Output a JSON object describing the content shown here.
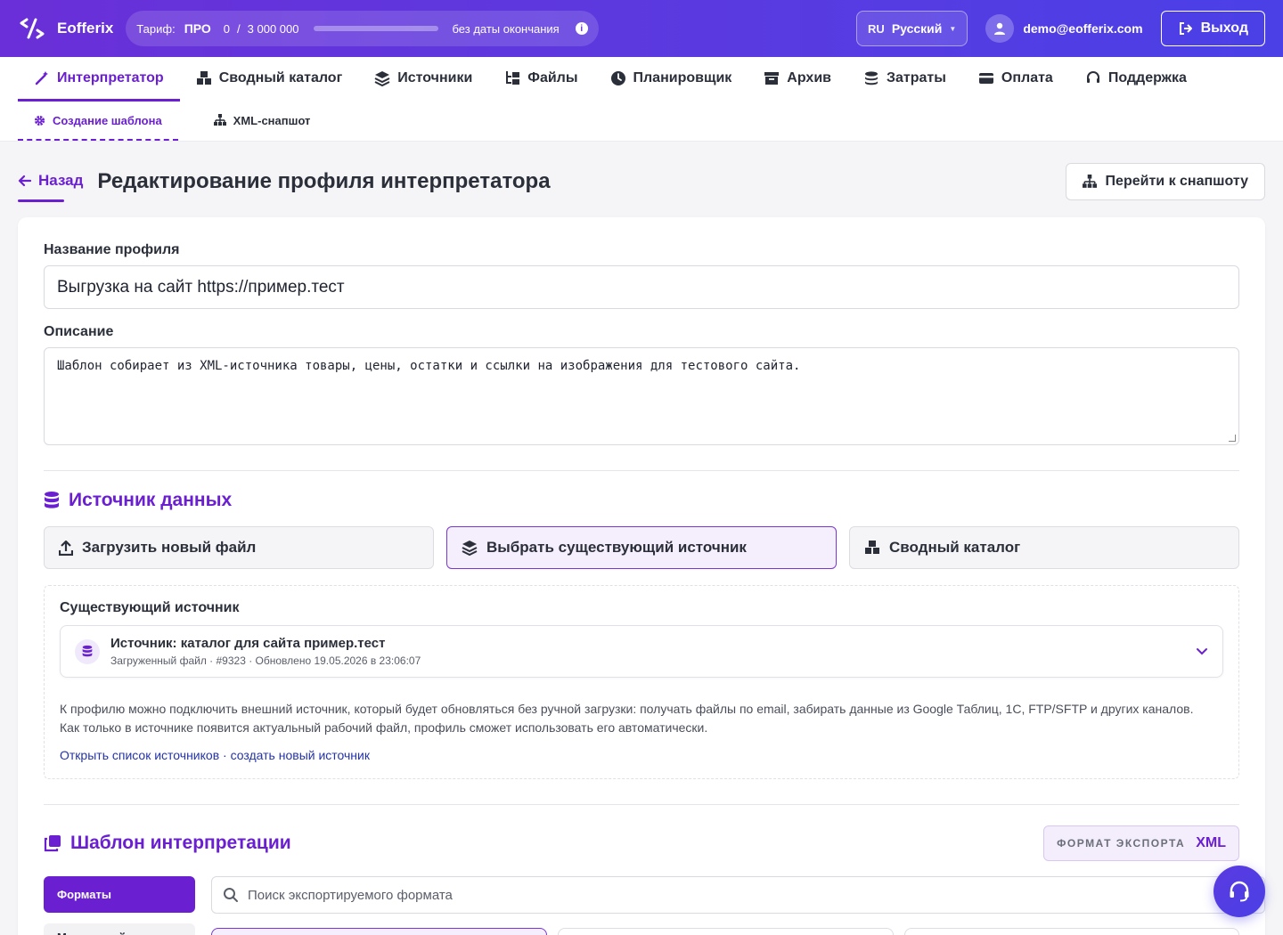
{
  "brand": {
    "name": "Eofferix"
  },
  "plan": {
    "label": "Тариф:",
    "name": "ПРО",
    "usage": "0",
    "separator": "/",
    "limit": "3 000 000",
    "usage_fraction": 0,
    "expiry": "без даты окончания"
  },
  "language": {
    "code": "RU",
    "name": "Русский"
  },
  "user": {
    "email": "demo@eofferix.com"
  },
  "logout_label": "Выход",
  "nav": [
    {
      "label": "Интерпретатор",
      "icon": "magic-wand-icon",
      "active": true
    },
    {
      "label": "Сводный каталог",
      "icon": "boxes-icon"
    },
    {
      "label": "Источники",
      "icon": "layers-icon"
    },
    {
      "label": "Файлы",
      "icon": "folder-tree-icon"
    },
    {
      "label": "Планировщик",
      "icon": "clock-icon"
    },
    {
      "label": "Архив",
      "icon": "archive-icon"
    },
    {
      "label": "Затраты",
      "icon": "coins-icon"
    },
    {
      "label": "Оплата",
      "icon": "credit-card-icon"
    },
    {
      "label": "Поддержка",
      "icon": "headset-icon"
    }
  ],
  "subnav": [
    {
      "label": "Создание шаблона",
      "icon": "gear-icon",
      "active": true
    },
    {
      "label": "XML-снапшот",
      "icon": "sitemap-icon"
    }
  ],
  "page": {
    "back_label": "Назад",
    "title": "Редактирование профиля интерпретатора",
    "snapshot_button": "Перейти к снапшоту"
  },
  "form": {
    "name_label": "Название профиля",
    "name_value": "Выгрузка на сайт https://пример.тест",
    "description_label": "Описание",
    "description_value": "Шаблон собирает из XML-источника товары, цены, остатки и ссылки на изображения для тестового сайта."
  },
  "data_source": {
    "title": "Источник данных",
    "options": [
      {
        "label": "Загрузить новый файл",
        "icon": "upload-icon"
      },
      {
        "label": "Выбрать существующий источник",
        "icon": "layers-icon",
        "active": true
      },
      {
        "label": "Сводный каталог",
        "icon": "boxes-icon"
      }
    ],
    "existing_label": "Существующий источник",
    "selected": {
      "title": "Источник: каталог для сайта пример.тест",
      "meta": "Загруженный файл · #9323 · Обновлено 19.05.2026 в 23:06:07"
    },
    "help_text": "К профилю можно подключить внешний источник, который будет обновляться без ручной загрузки: получать файлы по email, забирать данные из Google Таблиц, 1С, FTP/SFTP и других каналов. Как только в источнике появится актуальный рабочий файл, профиль сможет использовать его автоматически.",
    "link_list": "Открыть список источников",
    "link_sep": " · ",
    "link_create": "создать новый источник"
  },
  "template": {
    "title": "Шаблон интерпретации",
    "export_format_label": "ФОРМАТ ЭКСПОРТА",
    "export_format_value": "XML",
    "sidebar_active": "Форматы",
    "sidebar_next": "Маркетплейсы",
    "search_placeholder": "Поиск экспортируемого формата"
  },
  "colors": {
    "accent": "#6a1fd0",
    "header_gradient_start": "#6a2fd8",
    "header_gradient_end": "#4a40e6",
    "link": "#2433a8"
  }
}
